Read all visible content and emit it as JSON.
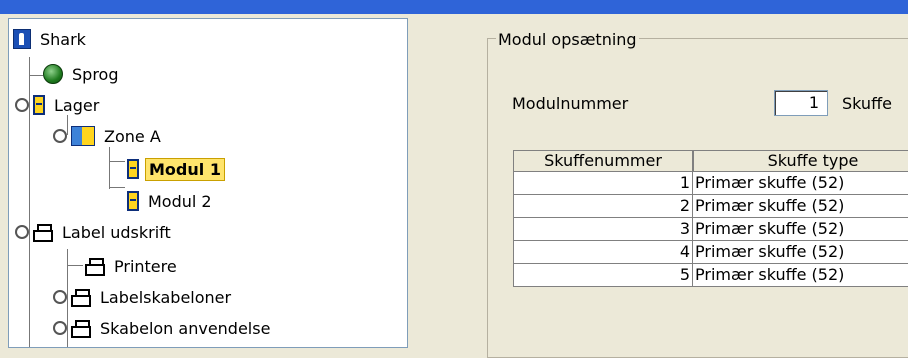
{
  "tree": {
    "items": [
      {
        "label": "Shark",
        "icon": "shark-icon"
      },
      {
        "label": "Sprog",
        "icon": "globe-icon"
      },
      {
        "label": "Lager",
        "icon": "cabinet-icon"
      },
      {
        "label": "Zone A",
        "icon": "zone-icon"
      },
      {
        "label": "Modul 1",
        "icon": "cabinet-icon",
        "selected": true
      },
      {
        "label": "Modul 2",
        "icon": "cabinet-icon"
      },
      {
        "label": "Label udskrift",
        "icon": "printer-icon"
      },
      {
        "label": "Printere",
        "icon": "printer-icon"
      },
      {
        "label": "Labelskabeloner",
        "icon": "printer-icon"
      },
      {
        "label": "Skabelon anvendelse",
        "icon": "printer-icon"
      }
    ]
  },
  "panel": {
    "group_title": "Modul opsætning",
    "modulnummer_label": "Modulnummer",
    "modulnummer_value": "1",
    "skuffe_label_truncated": "Skuffe",
    "grid": {
      "columns": [
        "Skuffenummer",
        "Skuffe type"
      ],
      "rows": [
        [
          "1",
          "Primær skuffe (52)"
        ],
        [
          "2",
          "Primær skuffe (52)"
        ],
        [
          "3",
          "Primær skuffe (52)"
        ],
        [
          "4",
          "Primær skuffe (52)"
        ],
        [
          "5",
          "Primær skuffe (52)"
        ]
      ]
    }
  },
  "colors": {
    "selected_bg": "#ffe46c",
    "window_bg": "#ece9d8",
    "title_bar": "#2f64d8"
  }
}
